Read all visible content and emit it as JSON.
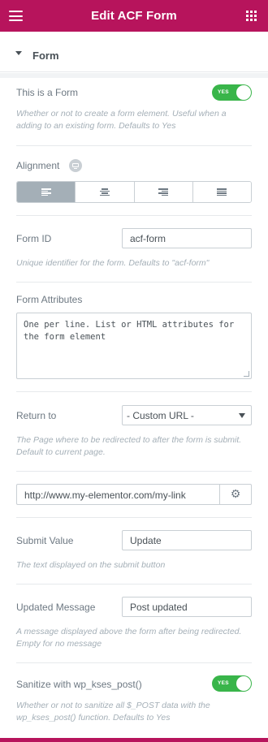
{
  "header": {
    "title": "Edit ACF Form",
    "menu_icon": "hamburger-icon",
    "apps_icon": "grid-icon"
  },
  "section": {
    "title": "Form"
  },
  "is_form": {
    "label": "This is a Form",
    "toggle_text": "YES",
    "description": "Whether or not to create a form element. Useful when a adding to an existing form. Defaults to Yes"
  },
  "alignment": {
    "label": "Alignment",
    "responsive_icon": "desktop-icon",
    "options": [
      "left",
      "center",
      "right",
      "justify"
    ],
    "selected": "left"
  },
  "form_id": {
    "label": "Form ID",
    "value": "acf-form",
    "description": "Unique identifier for the form. Defaults to \"acf-form\""
  },
  "form_attributes": {
    "label": "Form Attributes",
    "placeholder": "One per line. List or HTML attributes for the form element"
  },
  "return_to": {
    "label": "Return to",
    "selected": "- Custom URL -",
    "description": "The Page where to be redirected to after the form is submit. Default to current page."
  },
  "custom_url": {
    "value": "http://www.my-elementor.com/my-link",
    "settings_icon": "gear-icon"
  },
  "submit_value": {
    "label": "Submit Value",
    "value": "Update",
    "description": "The text displayed on the submit button"
  },
  "updated_message": {
    "label": "Updated Message",
    "value": "Post updated",
    "description": "A message displayed above the form after being redirected. Empty for no message"
  },
  "sanitize": {
    "label": "Sanitize with wp_kses_post()",
    "toggle_text": "YES",
    "description": "Whether or not to sanitize all $_POST data with the wp_kses_post() function. Defaults to Yes"
  },
  "colors": {
    "brand": "#b7145c",
    "toggle_on": "#39b54a",
    "active_align": "#a4afb7"
  }
}
